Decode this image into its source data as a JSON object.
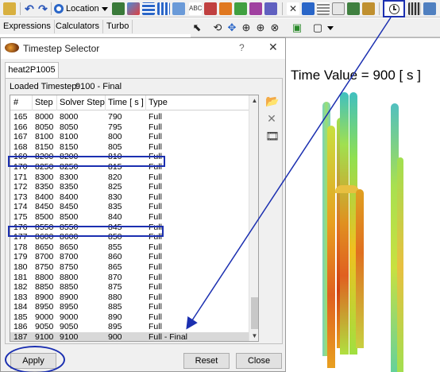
{
  "toolbar": {
    "location_label": "Location"
  },
  "side_tabs": [
    "Expressions",
    "Calculators",
    "Turbo"
  ],
  "viewport": {
    "time_label": "Time Value = 900 [ s ]"
  },
  "dialog": {
    "title": "Timestep Selector",
    "help": "?",
    "close_glyph": "✕",
    "tab": "heat2P1005",
    "loaded_label": "Loaded Timestep:",
    "loaded_value": "9100 - Final",
    "columns": [
      "#",
      "Step",
      "Solver Step",
      "Time [ s ]",
      "Type"
    ],
    "rows": [
      [
        "165",
        "8000",
        "8000",
        "790",
        "Full"
      ],
      [
        "166",
        "8050",
        "8050",
        "795",
        "Full"
      ],
      [
        "167",
        "8100",
        "8100",
        "800",
        "Full"
      ],
      [
        "168",
        "8150",
        "8150",
        "805",
        "Full"
      ],
      [
        "169",
        "8200",
        "8200",
        "810",
        "Full"
      ],
      [
        "170",
        "8250",
        "8250",
        "815",
        "Full"
      ],
      [
        "171",
        "8300",
        "8300",
        "820",
        "Full"
      ],
      [
        "172",
        "8350",
        "8350",
        "825",
        "Full"
      ],
      [
        "173",
        "8400",
        "8400",
        "830",
        "Full"
      ],
      [
        "174",
        "8450",
        "8450",
        "835",
        "Full"
      ],
      [
        "175",
        "8500",
        "8500",
        "840",
        "Full"
      ],
      [
        "176",
        "8550",
        "8550",
        "845",
        "Full"
      ],
      [
        "177",
        "8600",
        "8600",
        "850",
        "Full"
      ],
      [
        "178",
        "8650",
        "8650",
        "855",
        "Full"
      ],
      [
        "179",
        "8700",
        "8700",
        "860",
        "Full"
      ],
      [
        "180",
        "8750",
        "8750",
        "865",
        "Full"
      ],
      [
        "181",
        "8800",
        "8800",
        "870",
        "Full"
      ],
      [
        "182",
        "8850",
        "8850",
        "875",
        "Full"
      ],
      [
        "183",
        "8900",
        "8900",
        "880",
        "Full"
      ],
      [
        "184",
        "8950",
        "8950",
        "885",
        "Full"
      ],
      [
        "185",
        "9000",
        "9000",
        "890",
        "Full"
      ],
      [
        "186",
        "9050",
        "9050",
        "895",
        "Full"
      ],
      [
        "187",
        "9100",
        "9100",
        "900",
        "Full - Final"
      ]
    ],
    "buttons": {
      "apply": "Apply",
      "reset": "Reset",
      "close": "Close"
    }
  },
  "colors": {
    "annotation": "#1b2fb0",
    "selected_row": "#d8d8d8"
  }
}
